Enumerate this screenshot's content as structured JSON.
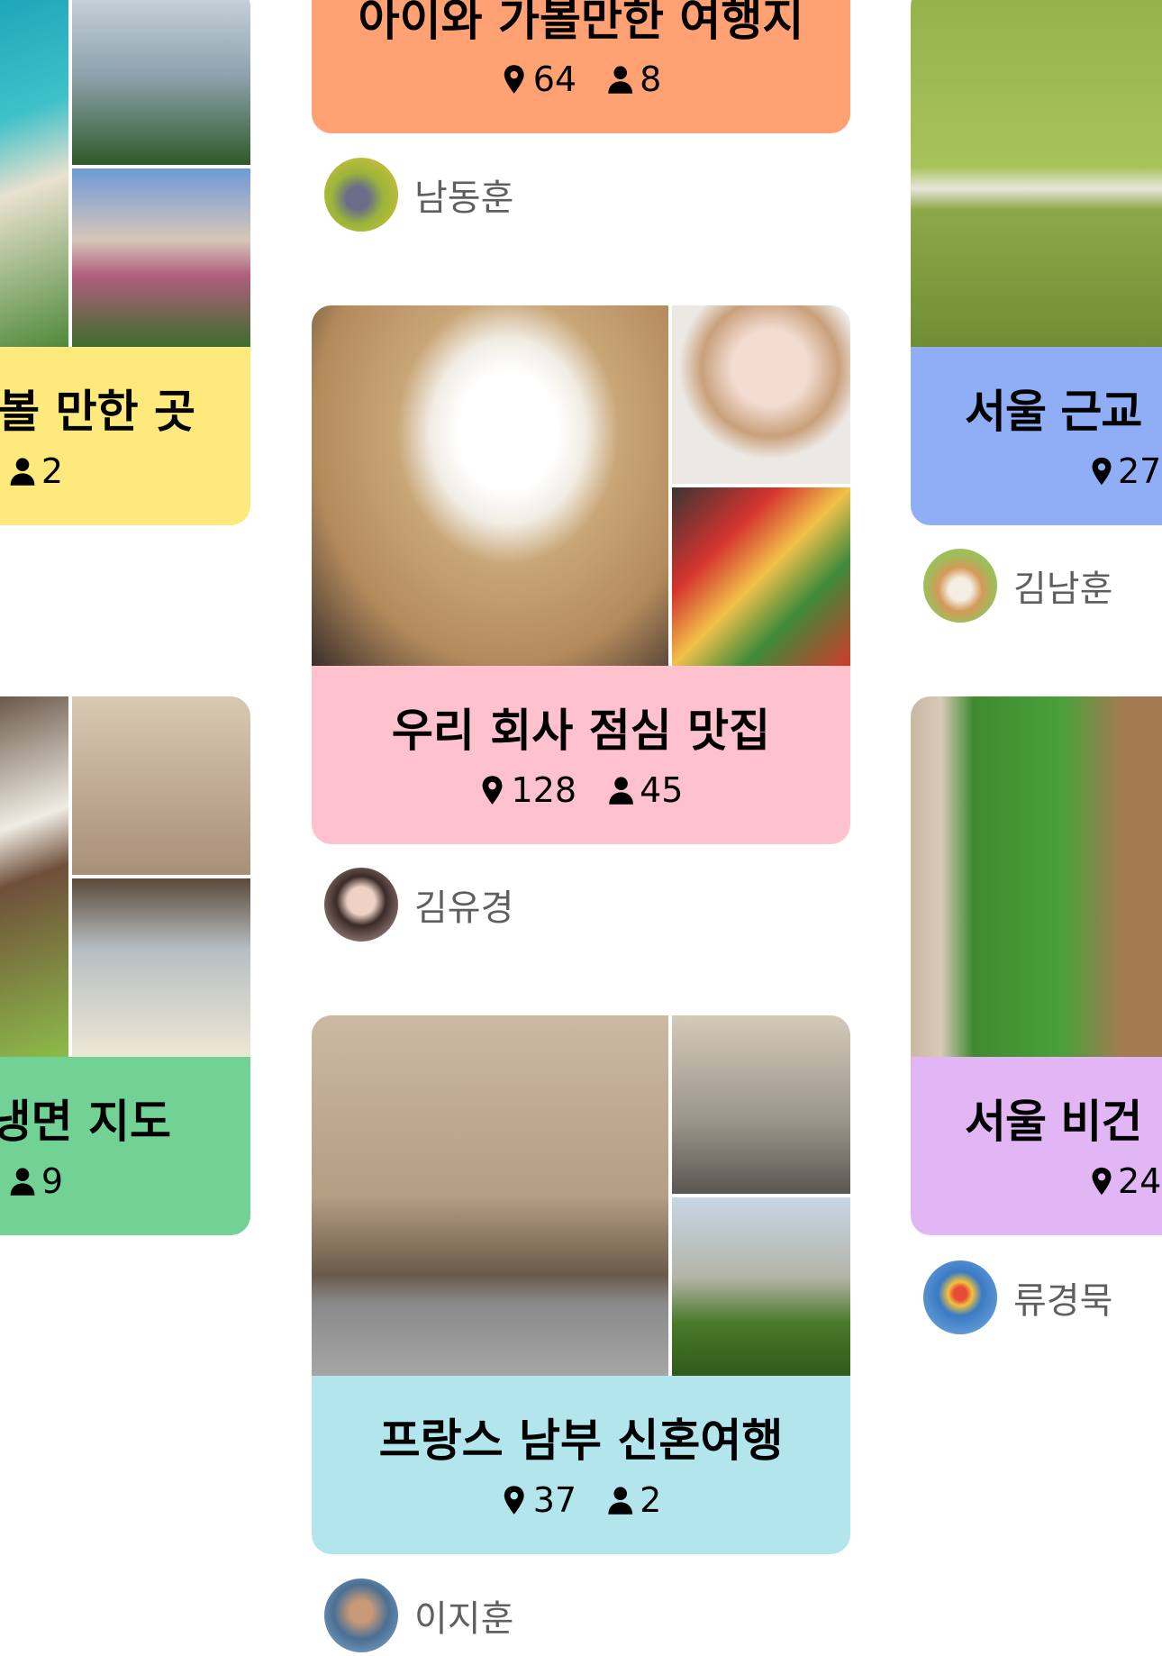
{
  "cards": [
    {
      "title": "아이와 가볼만한 여행지",
      "places": "64",
      "members": "8",
      "color": "#FFA173",
      "author": "남동훈"
    },
    {
      "title": "우리 회사 점심 맛집",
      "places": "128",
      "members": "45",
      "color": "#FFC1CE",
      "author": "김유경"
    },
    {
      "title": "프랑스 남부 신혼여행",
      "places": "37",
      "members": "2",
      "color": "#B3E6EC",
      "author": "이지훈"
    }
  ],
  "left_cards": [
    {
      "title_fragment": "볼 만한 곳",
      "members": "2",
      "color": "#FDE97C"
    },
    {
      "title_fragment": "냉면 지도",
      "members": "9",
      "color": "#72D295"
    }
  ],
  "right_cards": [
    {
      "title_fragment": "서울 근교",
      "places_fragment": "27",
      "color": "#8FAEF6",
      "author": "김남훈"
    },
    {
      "title_fragment": "서울 비건",
      "places_fragment": "24",
      "color": "#E2B6F5",
      "author": "류경묵"
    }
  ],
  "icons": {
    "places": "map-pin-icon",
    "members": "person-icon"
  }
}
